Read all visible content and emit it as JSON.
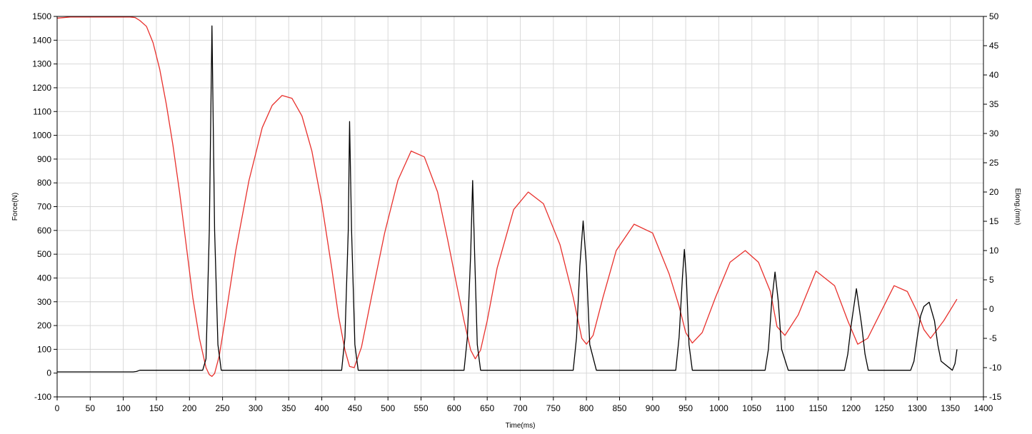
{
  "chart_data": {
    "type": "line",
    "xlabel": "Time(ms)",
    "ylabel_left": "Force(N)",
    "ylabel_right": "Elong.(mm)",
    "xlim": [
      0,
      1400
    ],
    "ylim_left": [
      -100,
      1500
    ],
    "ylim_right": [
      -15,
      50
    ],
    "x_ticks": [
      0,
      50,
      100,
      150,
      200,
      250,
      300,
      350,
      400,
      450,
      500,
      550,
      600,
      650,
      700,
      750,
      800,
      850,
      900,
      950,
      1000,
      1050,
      1100,
      1150,
      1200,
      1250,
      1300,
      1350,
      1400
    ],
    "y_ticks_left": [
      -100,
      0,
      100,
      200,
      300,
      400,
      500,
      600,
      700,
      800,
      900,
      1000,
      1100,
      1200,
      1300,
      1400,
      1500
    ],
    "y_ticks_right": [
      -15,
      -10,
      -5,
      0,
      5,
      10,
      15,
      20,
      25,
      30,
      35,
      40,
      45,
      50
    ],
    "grid": true,
    "colors": {
      "force": "#000000",
      "elong": "#e8302c",
      "grid": "#d9d9d9",
      "frame": "#000000"
    },
    "series": [
      {
        "axis": "left",
        "color": "#000000",
        "x": [
          0,
          115,
          120,
          125,
          130,
          220,
          225,
          230,
          234,
          238,
          243,
          248,
          255,
          430,
          435,
          440,
          442,
          445,
          450,
          455,
          460,
          615,
          620,
          625,
          628,
          631,
          635,
          640,
          645,
          780,
          785,
          790,
          795,
          800,
          805,
          815,
          935,
          940,
          945,
          948,
          951,
          955,
          960,
          970,
          1070,
          1075,
          1080,
          1085,
          1090,
          1095,
          1105,
          1190,
          1195,
          1200,
          1208,
          1216,
          1221,
          1226,
          1290,
          1295,
          1300,
          1305,
          1310,
          1318,
          1326,
          1331,
          1336,
          1353,
          1357,
          1360
        ],
        "values": [
          5,
          5,
          7,
          12,
          12,
          12,
          60,
          600,
          1460,
          600,
          120,
          12,
          12,
          12,
          150,
          600,
          1058,
          600,
          120,
          12,
          12,
          12,
          150,
          500,
          810,
          500,
          120,
          12,
          12,
          12,
          150,
          450,
          640,
          450,
          120,
          12,
          12,
          150,
          400,
          520,
          400,
          120,
          12,
          12,
          12,
          100,
          300,
          425,
          300,
          100,
          12,
          12,
          80,
          200,
          355,
          200,
          80,
          12,
          12,
          50,
          150,
          240,
          280,
          298,
          220,
          120,
          50,
          12,
          40,
          100
        ]
      },
      {
        "axis": "right",
        "color": "#e8302c",
        "x": [
          0,
          20,
          60,
          100,
          110,
          118,
          125,
          135,
          145,
          155,
          165,
          175,
          185,
          195,
          205,
          215,
          225,
          230,
          234,
          238,
          245,
          255,
          270,
          290,
          310,
          325,
          340,
          355,
          370,
          385,
          400,
          415,
          425,
          435,
          442,
          449,
          460,
          475,
          495,
          515,
          535,
          555,
          575,
          590,
          605,
          615,
          625,
          632,
          640,
          650,
          665,
          690,
          712,
          735,
          760,
          780,
          793,
          800,
          810,
          825,
          845,
          872,
          900,
          925,
          940,
          950,
          960,
          975,
          995,
          1017,
          1040,
          1060,
          1078,
          1088,
          1100,
          1120,
          1147,
          1175,
          1195,
          1210,
          1225,
          1245,
          1265,
          1285,
          1300,
          1310,
          1320,
          1340,
          1360
        ],
        "values": [
          49.7,
          49.9,
          49.9,
          49.9,
          49.9,
          49.8,
          49.3,
          48.3,
          45.5,
          41.0,
          35.0,
          28.0,
          20.0,
          11.0,
          2.0,
          -5.0,
          -10.0,
          -11.2,
          -11.5,
          -11.0,
          -8.0,
          -1.0,
          10.0,
          22.0,
          31.0,
          34.8,
          36.5,
          36.0,
          33.0,
          27.0,
          18.0,
          7.0,
          -1.0,
          -7.0,
          -9.8,
          -10.0,
          -6.5,
          2.0,
          13.0,
          22.0,
          27.0,
          26.0,
          20.0,
          12.0,
          3.5,
          -2.0,
          -7.0,
          -8.5,
          -7.0,
          -2.0,
          7.0,
          17.0,
          20.0,
          18.0,
          11.0,
          2.0,
          -5.0,
          -6.0,
          -4.5,
          2.0,
          10.0,
          14.5,
          13.0,
          6.0,
          0.5,
          -4.0,
          -5.8,
          -4.0,
          2.0,
          8.0,
          10.0,
          8.0,
          3.0,
          -3.0,
          -4.5,
          -1.0,
          6.5,
          4.0,
          -2.0,
          -6.0,
          -5.0,
          -0.5,
          4.0,
          3.0,
          -0.5,
          -3.5,
          -5.0,
          -2.0,
          1.7
        ]
      }
    ]
  }
}
